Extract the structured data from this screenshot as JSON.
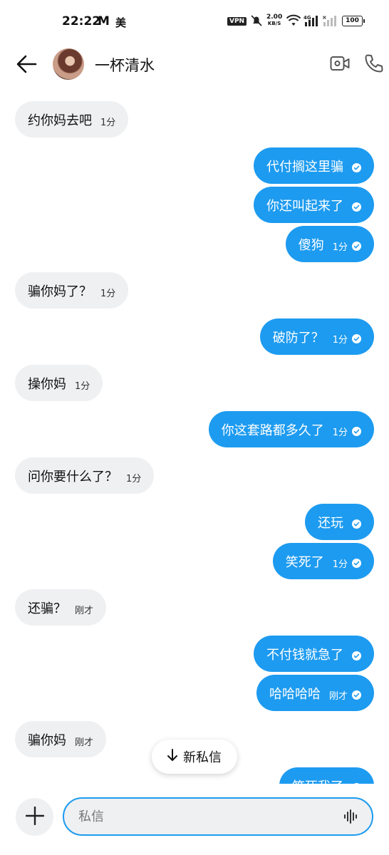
{
  "status_bar": {
    "time": "22:22",
    "app_icon_m": "M",
    "app_icon_mei": "美",
    "vpn": "VPN",
    "speed_value": "2.00",
    "speed_unit": "KB/S",
    "battery": "100"
  },
  "header": {
    "name": "一杯清水"
  },
  "messages": [
    {
      "dir": "in",
      "text": "约你妈去吧",
      "time": "1分"
    },
    {
      "dir": "out",
      "text": "代付搁这里骗",
      "time": ""
    },
    {
      "dir": "out",
      "text": "你还叫起来了",
      "time": ""
    },
    {
      "dir": "out",
      "text": "傻狗",
      "time": "1分"
    },
    {
      "dir": "in",
      "text": "骗你妈了？",
      "time": "1分"
    },
    {
      "dir": "out",
      "text": "破防了？",
      "time": "1分"
    },
    {
      "dir": "in",
      "text": "操你妈",
      "time": "1分"
    },
    {
      "dir": "out",
      "text": "你这套路都多久了",
      "time": "1分"
    },
    {
      "dir": "in",
      "text": "问你要什么了？",
      "time": "1分"
    },
    {
      "dir": "out",
      "text": "还玩",
      "time": ""
    },
    {
      "dir": "out",
      "text": "笑死了",
      "time": "1分"
    },
    {
      "dir": "in",
      "text": "还骗？",
      "time": "刚才"
    },
    {
      "dir": "out",
      "text": "不付钱就急了",
      "time": ""
    },
    {
      "dir": "out",
      "text": "哈哈哈哈",
      "time": "刚才"
    },
    {
      "dir": "in",
      "text": "骗你妈",
      "time": "刚才"
    },
    {
      "dir": "out",
      "text": "笑死我了",
      "time": ""
    }
  ],
  "new_message_pill": "新私信",
  "composer": {
    "placeholder": "私信"
  },
  "colors": {
    "accent": "#1d9bf0",
    "incoming_bubble": "#eff0f2"
  }
}
